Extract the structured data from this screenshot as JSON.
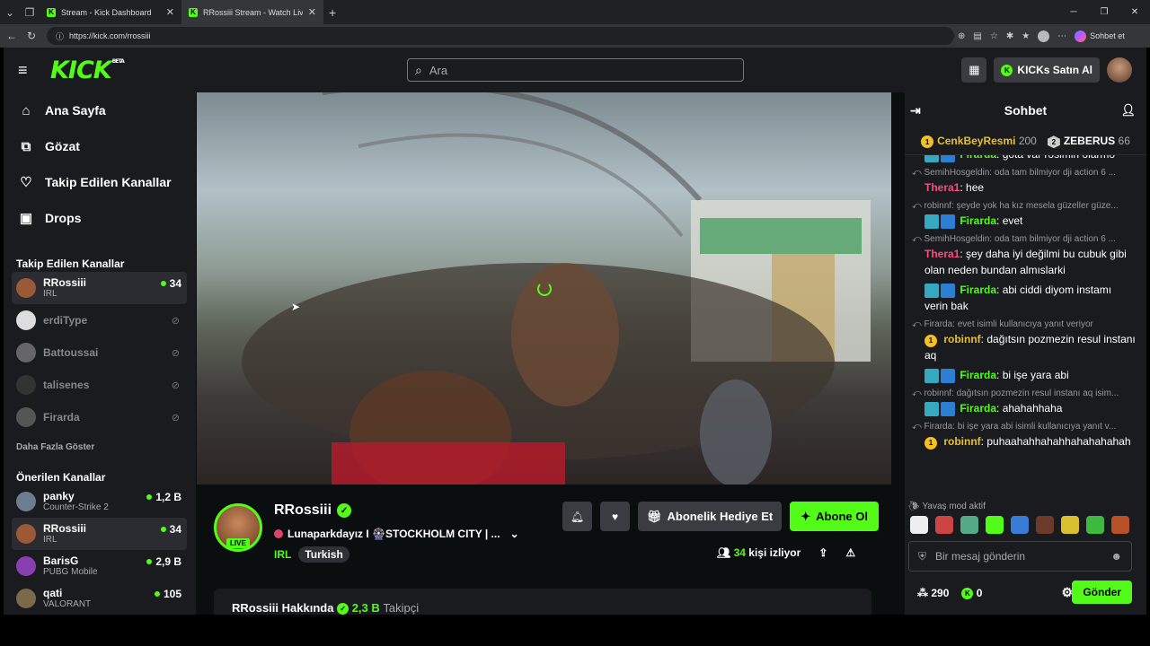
{
  "browser": {
    "tabs": [
      {
        "title": "Stream - Kick Dashboard"
      },
      {
        "title": "RRossiii Stream - Watch Live on Kick"
      }
    ],
    "url": "https://kick.com/rrossiii",
    "sohbet_label": "Sohbet et"
  },
  "header": {
    "logo": "KICK",
    "beta": "BETA",
    "search_placeholder": "Ara",
    "kicks_label": "KICKs Satın Al"
  },
  "sidebar": {
    "nav": [
      {
        "label": "Ana Sayfa",
        "icon": "home-icon"
      },
      {
        "label": "Gözat",
        "icon": "browse-icon"
      },
      {
        "label": "Takip Edilen Kanallar",
        "icon": "heart-icon"
      },
      {
        "label": "Drops",
        "icon": "gift-icon"
      }
    ],
    "followed_title": "Takip Edilen Kanallar",
    "followed": [
      {
        "name": "RRossiii",
        "sub": "IRL",
        "viewers": "34",
        "live": true
      },
      {
        "name": "erdiType",
        "live": false
      },
      {
        "name": "Battoussai",
        "live": false
      },
      {
        "name": "talisenes",
        "live": false
      },
      {
        "name": "Firarda",
        "live": false
      }
    ],
    "show_more": "Daha Fazla Göster",
    "recommended_title": "Önerilen Kanallar",
    "recommended": [
      {
        "name": "panky",
        "sub": "Counter-Strike 2",
        "viewers": "1,2 B"
      },
      {
        "name": "RRossiii",
        "sub": "IRL",
        "viewers": "34"
      },
      {
        "name": "BarisG",
        "sub": "PUBG Mobile",
        "viewers": "2,9 B"
      },
      {
        "name": "qati",
        "sub": "VALORANT",
        "viewers": "105"
      }
    ]
  },
  "stream": {
    "channel": "RRossiii",
    "live_badge": "LIVE",
    "title": "Lunaparkdayız I 🎡STOCKHOLM CITY | ...",
    "category": "IRL",
    "tag": "Turkish",
    "gift_label": "Abonelik Hediye Et",
    "subscribe_label": "Abone Ol",
    "viewer_count": "34",
    "viewer_suffix": "kişi izliyor",
    "about_title": "RRossiii Hakkında",
    "followers": "2,3 B",
    "followers_label": "Takipçi"
  },
  "chat": {
    "title": "Sohbet",
    "pinned": [
      {
        "name": "CenkBeyResmi",
        "count": "200",
        "rank": "1"
      },
      {
        "name": "ZEBERUS",
        "count": "66",
        "rank": "2"
      }
    ],
    "messages": [
      {
        "type": "msg",
        "user": "Firarda",
        "cls": "u-fir",
        "badges": true,
        "text": "gota var rosimin olarmo"
      },
      {
        "type": "reply",
        "text": "SemihHosgeldin: oda tam bilmiyor dji action 6 ..."
      },
      {
        "type": "msg",
        "user": "Thera1",
        "cls": "u-the",
        "badges": false,
        "text": "hee"
      },
      {
        "type": "reply",
        "text": "robinnf: şeyde yok ha kız mesela güzeller güze..."
      },
      {
        "type": "msg",
        "user": "Firarda",
        "cls": "u-fir",
        "badges": true,
        "text": "evet"
      },
      {
        "type": "reply",
        "text": "SemihHosgeldin: oda tam bilmiyor dji action 6 ..."
      },
      {
        "type": "msg",
        "user": "Thera1",
        "cls": "u-the",
        "badges": false,
        "text": "şey daha iyi değilmi bu cubuk gibi olan neden bundan almıslarki"
      },
      {
        "type": "msg",
        "user": "Firarda",
        "cls": "u-fir",
        "badges": true,
        "text": "abi ciddi diyom instamı verin bak"
      },
      {
        "type": "reply",
        "text": "Firarda: evet isimli kullanıcıya yanıt veriyor"
      },
      {
        "type": "msg",
        "user": "robinnf",
        "cls": "u-rob",
        "badges": false,
        "coin": true,
        "text": "dağıtsın pozmezin resul instanı aq"
      },
      {
        "type": "msg",
        "user": "Firarda",
        "cls": "u-fir",
        "badges": true,
        "text": "bi işe yara abi"
      },
      {
        "type": "reply",
        "text": "robinnf: dağıtsın pozmezin resul instanı aq isim..."
      },
      {
        "type": "msg",
        "user": "Firarda",
        "cls": "u-fir",
        "badges": true,
        "text": "ahahahhaha"
      },
      {
        "type": "reply",
        "text": "Firarda: bi işe yara abi isimli kullanıcıya yanıt v..."
      },
      {
        "type": "msg",
        "user": "robinnf",
        "cls": "u-rob",
        "badges": false,
        "coin": true,
        "text": "puhaahahhahahhahahahahah"
      }
    ],
    "slow_mode": "Yavaş mod aktif",
    "input_placeholder": "Bir mesaj gönderin",
    "points": "290",
    "kicks": "0",
    "send_label": "Gönder"
  },
  "colors": {
    "accent": "#53fc18",
    "bg": "#191b1f",
    "thera": "#ff4b82",
    "robin": "#e7c030"
  }
}
